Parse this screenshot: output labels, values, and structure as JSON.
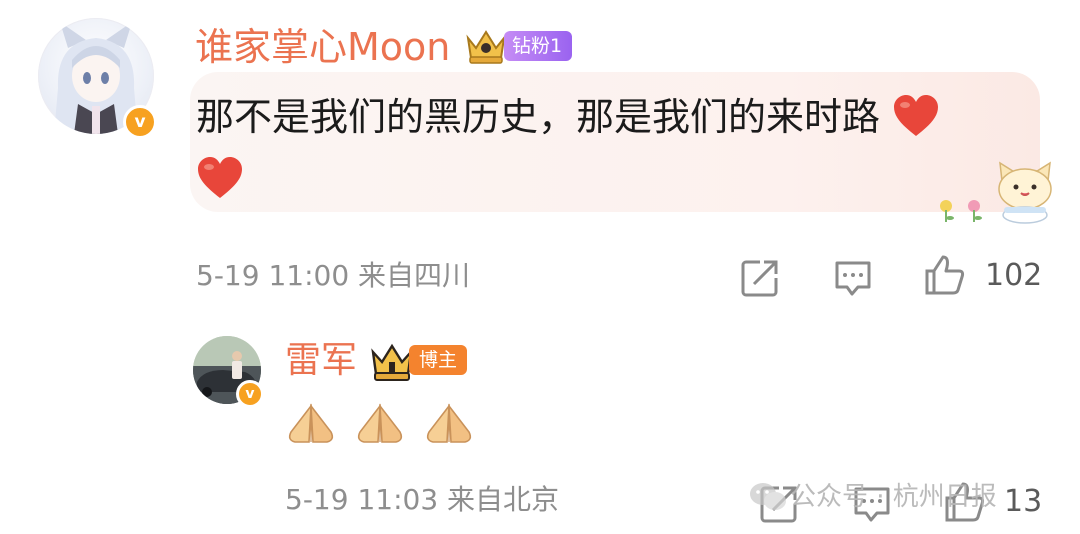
{
  "comment": {
    "username": "谁家掌心Moon",
    "fan_badge": "钻粉1",
    "verified_mark": "v",
    "text": "那不是我们的黑历史，那是我们的来时路",
    "emoji": "heart-emoji",
    "meta": "5-19 11:00  来自四川",
    "actions": {
      "share_icon": "share-icon",
      "comment_icon": "comment-icon",
      "like_icon": "thumbs-up-icon",
      "like_count": "102"
    }
  },
  "reply": {
    "username": "雷军",
    "blogger_badge": "博主",
    "verified_mark": "v",
    "emojis": [
      "pray-emoji",
      "pray-emoji",
      "pray-emoji"
    ],
    "meta": "5-19 11:03  来自北京",
    "actions": {
      "share_icon": "share-icon",
      "comment_icon": "comment-icon",
      "like_icon": "thumbs-up-icon",
      "like_count": "13"
    }
  },
  "watermark": "公众号 · 杭州日报",
  "colors": {
    "username": "#eb7350",
    "meta_gray": "#8e8e8e",
    "bubble_bg": "#fdf3f0",
    "verified_orange": "#f7a120",
    "fan_badge_purple": "#a56ef2",
    "blogger_badge_orange": "#f4832e",
    "heart_red": "#e8463a"
  }
}
